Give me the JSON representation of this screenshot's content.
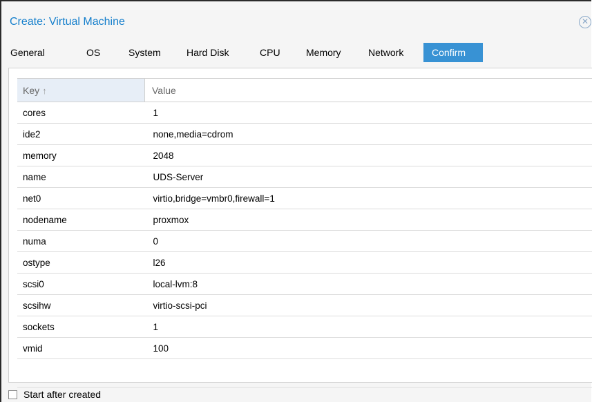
{
  "dialog": {
    "title": "Create: Virtual Machine",
    "close_icon": "close-icon"
  },
  "tabs": [
    {
      "label": "General"
    },
    {
      "label": "OS"
    },
    {
      "label": "System"
    },
    {
      "label": "Hard Disk"
    },
    {
      "label": "CPU"
    },
    {
      "label": "Memory"
    },
    {
      "label": "Network"
    },
    {
      "label": "Confirm",
      "active": true
    }
  ],
  "grid": {
    "headers": {
      "key": "Key",
      "value": "Value",
      "sort_icon": "sort-ascending-icon"
    },
    "rows": [
      {
        "key": "cores",
        "value": "1"
      },
      {
        "key": "ide2",
        "value": "none,media=cdrom"
      },
      {
        "key": "memory",
        "value": "2048"
      },
      {
        "key": "name",
        "value": "UDS-Server"
      },
      {
        "key": "net0",
        "value": "virtio,bridge=vmbr0,firewall=1"
      },
      {
        "key": "nodename",
        "value": "proxmox"
      },
      {
        "key": "numa",
        "value": "0"
      },
      {
        "key": "ostype",
        "value": "l26"
      },
      {
        "key": "scsi0",
        "value": "local-lvm:8"
      },
      {
        "key": "scsihw",
        "value": "virtio-scsi-pci"
      },
      {
        "key": "sockets",
        "value": "1"
      },
      {
        "key": "vmid",
        "value": "100"
      }
    ]
  },
  "footer": {
    "start_after_created_label": "Start after created",
    "start_after_created_checked": false
  },
  "colors": {
    "accent": "#157fcc",
    "active_tab": "#3892d4",
    "header_key_bg": "#e7eef7"
  }
}
